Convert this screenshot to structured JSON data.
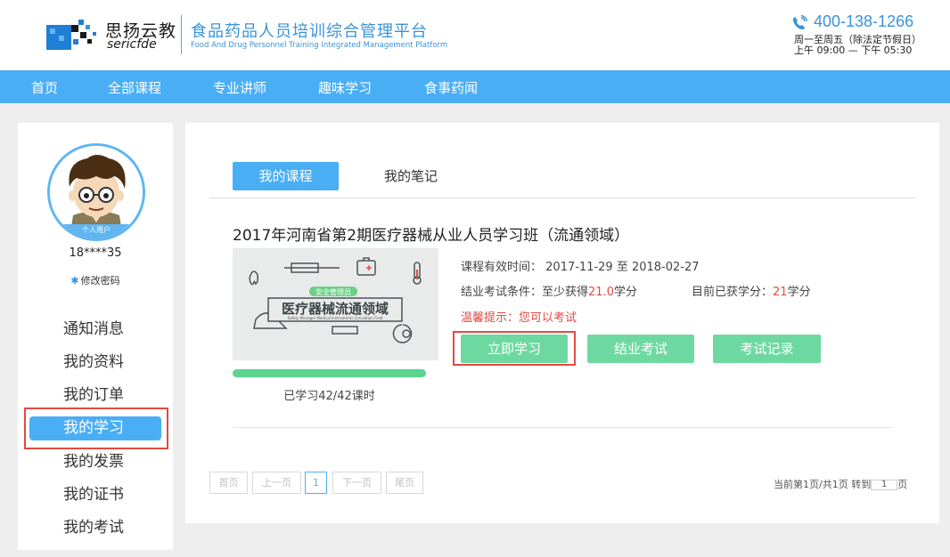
{
  "header": {
    "brand_cn": "思扬云教",
    "brand_en": "sericfde",
    "platform_cn": "食品药品人员培训综合管理平台",
    "platform_en": "Food And Drug Personnel Training Integrated Management Platform",
    "phone": "400-138-1266",
    "hours_line1": "周一至周五（除法定节假日）",
    "hours_line2": "上午 09:00 — 下午 05:30"
  },
  "nav": {
    "items": [
      "首页",
      "全部课程",
      "专业讲师",
      "趣味学习",
      "食事药闻"
    ]
  },
  "sidebar": {
    "avatar_tag": "个人用户",
    "user": "18****35",
    "change_password": "修改密码",
    "items": [
      "通知消息",
      "我的资料",
      "我的订单",
      "我的学习",
      "我的发票",
      "我的证书",
      "我的考试"
    ],
    "active_index": 3
  },
  "main": {
    "tabs": [
      "我的课程",
      "我的笔记"
    ],
    "active_tab": 0,
    "course": {
      "title": "2017年河南省第2期医疗器械从业人员学习班（流通领域）",
      "thumb_badge": "安全管理员",
      "thumb_title": "医疗器械流通领域",
      "thumb_subtitle": "Safety Manager Medical Instruments Circulation Field",
      "validity_label": "课程有效时间：",
      "validity_value": "2017-11-29 至 2018-02-27",
      "exam_cond_label": "结业考试条件：至少获得",
      "exam_cond_value": "21.0",
      "exam_cond_unit": "学分",
      "earned_label": "目前已获学分：",
      "earned_value": "21",
      "earned_unit": "学分",
      "tip": "温馨提示：您可以考试",
      "progress_text": "已学习42/42课时",
      "progress_fraction": 1.0,
      "buttons": [
        "立即学习",
        "结业考试",
        "考试记录"
      ]
    },
    "pagination": {
      "first": "首页",
      "prev": "上一页",
      "current": "1",
      "next": "下一页",
      "last": "尾页",
      "info_pre": "当前第",
      "info_page": "1",
      "info_mid": "页/共",
      "info_total": "1",
      "info_post": "页 转到",
      "goto_value": "1",
      "goto_unit": "页"
    }
  },
  "colors": {
    "accent": "#4aaef5",
    "button_green": "#6dd9a1",
    "progress_green": "#5bd48e",
    "highlight_red": "#e24a43",
    "brand_blue": "#3a93d9"
  }
}
